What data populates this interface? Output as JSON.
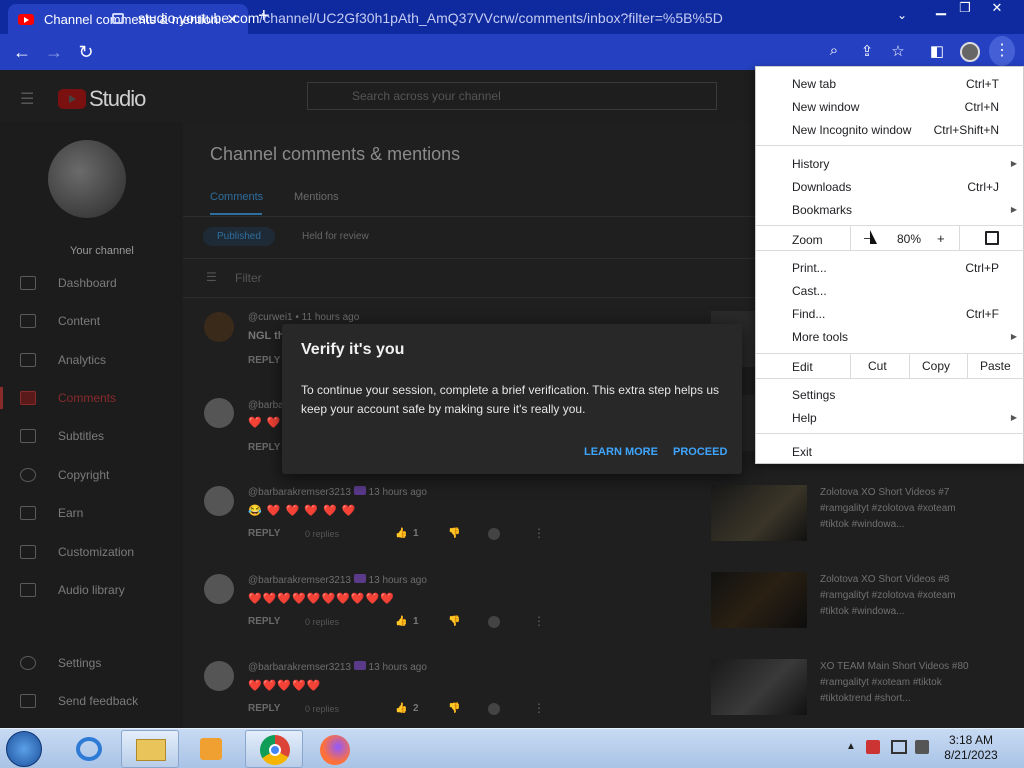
{
  "browser": {
    "tab_title": "Channel comments & mentions -",
    "url_host": "studio.youtube.com",
    "url_path": "/channel/UC2Gf30h1pAth_AmQ37VVcrw/comments/inbox?filter=%5B%5D"
  },
  "studio": {
    "logo_text": "Studio",
    "search_placeholder": "Search across your channel",
    "your_channel": "Your channel",
    "sidebar": [
      "Dashboard",
      "Content",
      "Analytics",
      "Comments",
      "Subtitles",
      "Copyright",
      "Earn",
      "Customization",
      "Audio library"
    ],
    "settings": "Settings",
    "send_feedback": "Send feedback",
    "page_title": "Channel comments & mentions",
    "tabs": [
      "Comments",
      "Mentions"
    ],
    "chips": [
      "Published",
      "Held for review"
    ],
    "filter": "Filter",
    "comments": [
      {
        "author": "@curwei1",
        "time": "11 hours ago",
        "text": "NGL the",
        "replies": "",
        "likes": ""
      },
      {
        "author": "@barba",
        "time": "",
        "text": "❤️ ❤️",
        "replies": "",
        "likes": ""
      },
      {
        "author": "@barbarakremser3213",
        "time": "13 hours ago",
        "text": "😂 ❤️ ❤️ ❤️ ❤️ ❤️",
        "replies": "0 replies",
        "likes": "1"
      },
      {
        "author": "@barbarakremser3213",
        "time": "13 hours ago",
        "text": "❤️❤️❤️❤️❤️❤️❤️❤️❤️❤️",
        "replies": "0 replies",
        "likes": "1"
      },
      {
        "author": "@barbarakremser3213",
        "time": "13 hours ago",
        "text": "❤️❤️❤️❤️❤️",
        "replies": "0 replies",
        "likes": "2"
      }
    ],
    "reply_label": "REPLY",
    "videos": [
      {
        "title": "Zolotova XO Short Videos #7 #ramgalityt #zolotova #xoteam #tiktok #windowa..."
      },
      {
        "title": "Zolotova XO Short Videos #8 #ramgalityt #zolotova #xoteam #tiktok #windowa..."
      },
      {
        "title": "XO TEAM Main Short Videos #80 #ramgalityt #xoteam #tiktok #tiktoktrend #short..."
      }
    ]
  },
  "modal": {
    "title": "Verify it's you",
    "body": "To continue your session, complete a brief verification. This extra step helps us keep your account safe by making sure it's really you.",
    "learn_more": "LEARN MORE",
    "proceed": "PROCEED"
  },
  "menu": {
    "new_tab": "New tab",
    "new_tab_sc": "Ctrl+T",
    "new_window": "New window",
    "new_window_sc": "Ctrl+N",
    "incognito": "New Incognito window",
    "incognito_sc": "Ctrl+Shift+N",
    "history": "History",
    "downloads": "Downloads",
    "downloads_sc": "Ctrl+J",
    "bookmarks": "Bookmarks",
    "zoom": "Zoom",
    "zoom_minus": "–",
    "zoom_value": "80%",
    "zoom_plus": "+",
    "print": "Print...",
    "print_sc": "Ctrl+P",
    "cast": "Cast...",
    "find": "Find...",
    "find_sc": "Ctrl+F",
    "more_tools": "More tools",
    "edit": "Edit",
    "cut": "Cut",
    "copy": "Copy",
    "paste": "Paste",
    "settings": "Settings",
    "help": "Help",
    "exit": "Exit"
  },
  "taskbar": {
    "time": "3:18 AM",
    "date": "8/21/2023"
  },
  "colors": {
    "chrome_blue": "#2541c2",
    "link_blue": "#3ea6ff"
  }
}
